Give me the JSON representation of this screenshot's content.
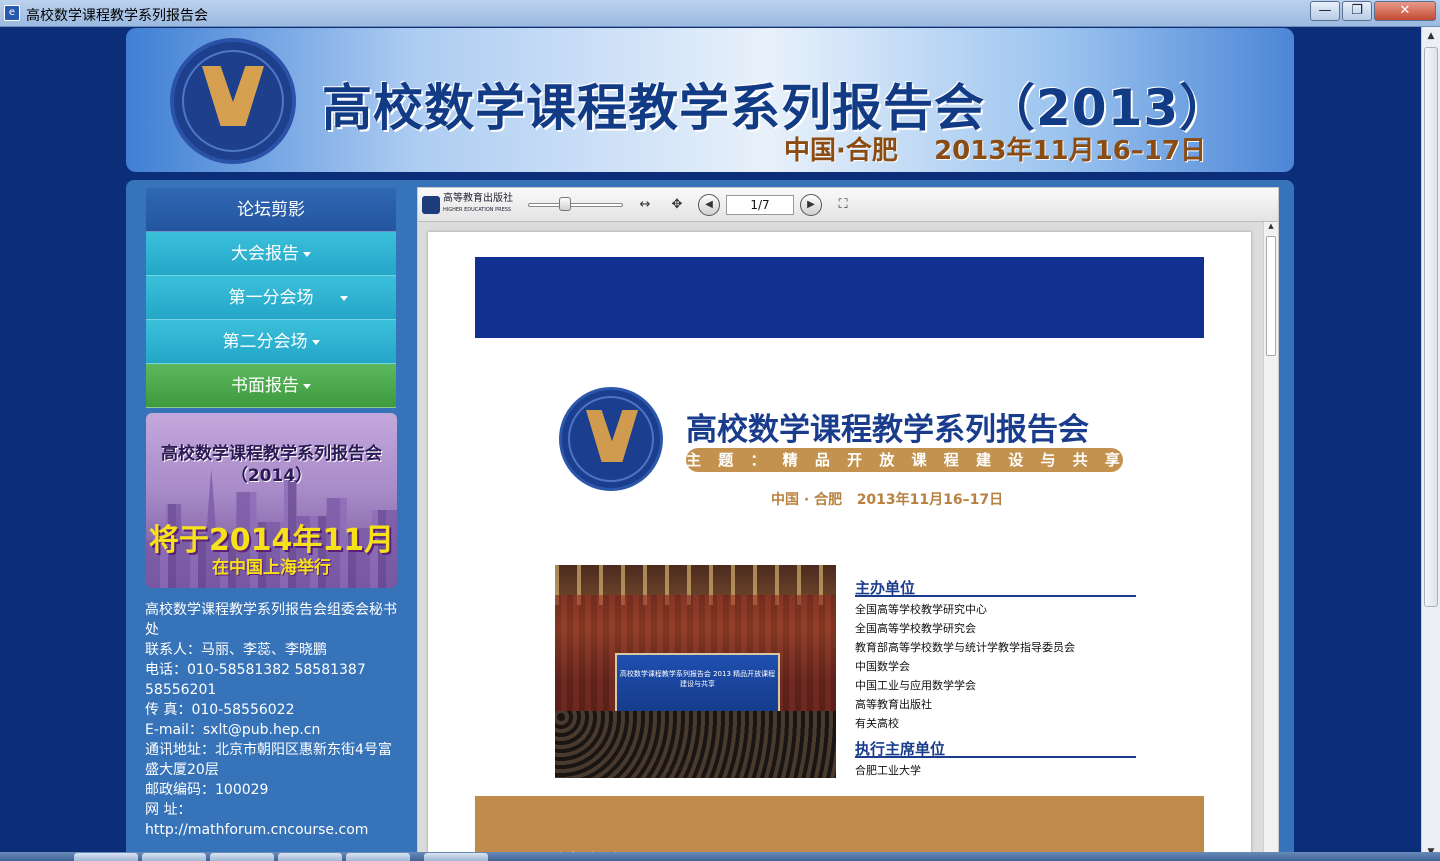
{
  "window": {
    "title": "高校数学课程教学系列报告会",
    "buttons": {
      "min": "—",
      "max": "❐",
      "close": "✕"
    }
  },
  "banner": {
    "title": "高校数学课程教学系列报告会（2013）",
    "subtitle": "中国·合肥    2013年11月16–17日"
  },
  "sidebar": {
    "header": "论坛剪影",
    "items": [
      {
        "label": "大会报告",
        "style": "cyan"
      },
      {
        "label": "第一分会场",
        "style": "cyan"
      },
      {
        "label": "第二分会场",
        "style": "cyan"
      },
      {
        "label": "书面报告",
        "style": "green"
      }
    ]
  },
  "promo": {
    "line1": "高校数学课程教学系列报告会",
    "line2": "（2014）",
    "line3": "将于2014年11月",
    "line4": "在中国上海举行"
  },
  "contact": {
    "org": "高校数学课程教学系列报告会组委会秘书处",
    "people": "联系人：马丽、李蕊、李晓鹏",
    "phone": "电话：010-58581382 58581387 58556201",
    "fax": "传 真：010-58556022",
    "email": "E-mail：sxlt@pub.hep.cn",
    "address": "通讯地址：北京市朝阳区惠新东街4号富盛大厦20层",
    "postcode": "邮政编码：100029",
    "site_label": "网 址：",
    "site_url": "http://mathforum.cncourse.com"
  },
  "viewer": {
    "publisher_cn": "高等教育出版社",
    "publisher_en": "HIGHER EDUCATION PRESS",
    "page_indicator": "1/7",
    "zoom_level": 0.35
  },
  "document": {
    "title": "高校数学课程教学系列报告会",
    "theme": "主 题 ： 精 品 开 放 课 程 建 设 与 共 享",
    "date": "中国 · 合肥   2013年11月16–17日",
    "photo_screen_text": "高校数学课程教学系列报告会 2013 精品开放课程建设与共享",
    "sponsors_title": "主办单位",
    "sponsors": [
      "全国高等学校教学研究中心",
      "全国高等学校教学研究会",
      "教育部高等学校数学与统计学教学指导委员会",
      "中国数学会",
      "中国工业与应用数学学会",
      "高等教育出版社",
      "有关高校"
    ],
    "exec_title": "执行主席单位",
    "exec": "合肥工业大学",
    "committee_title": "组织委员会"
  },
  "colors": {
    "page_bg": "#0c2e78",
    "panel": "#3673b8",
    "nav_cyan": "#2fb3d1",
    "nav_green": "#4caf50",
    "doc_blue": "#12308f",
    "doc_gold": "#c3924f"
  }
}
